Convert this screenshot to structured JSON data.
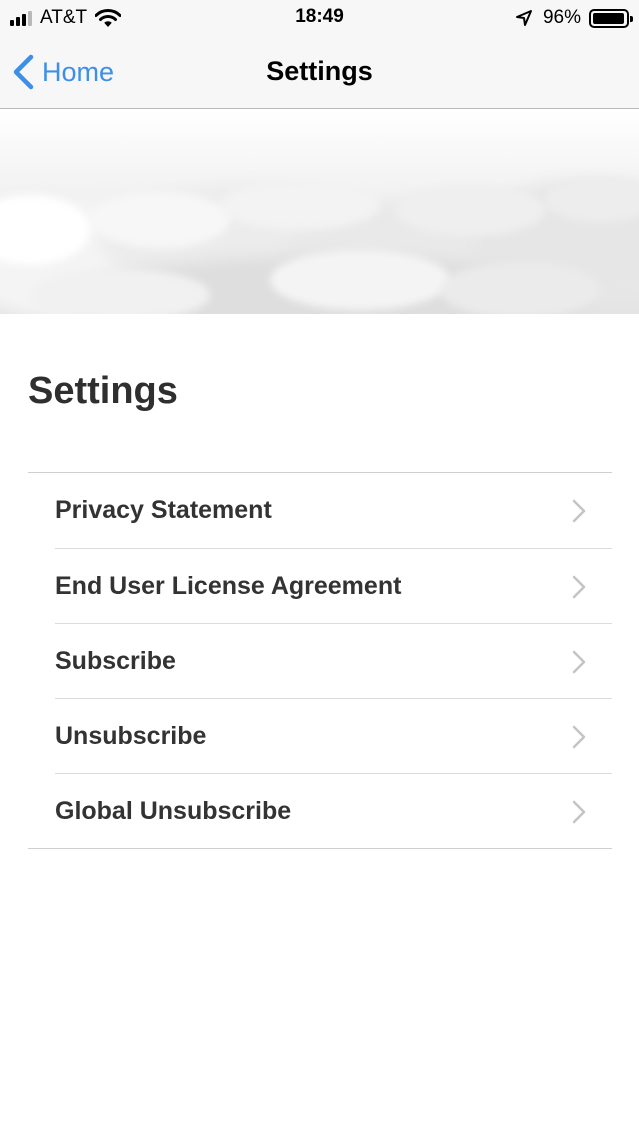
{
  "status_bar": {
    "carrier": "AT&T",
    "time": "18:49",
    "battery_percent": "96%",
    "battery_level": 0.96,
    "icons": [
      "signal-icon",
      "wifi-icon",
      "location-arrow-icon",
      "battery-icon"
    ]
  },
  "nav": {
    "back_label": "Home",
    "title": "Settings",
    "accent_color": "#3d8fe8"
  },
  "page": {
    "heading": "Settings"
  },
  "settings_items": [
    {
      "label": "Privacy Statement"
    },
    {
      "label": "End User License Agreement"
    },
    {
      "label": "Subscribe"
    },
    {
      "label": "Unsubscribe"
    },
    {
      "label": "Global Unsubscribe"
    }
  ]
}
